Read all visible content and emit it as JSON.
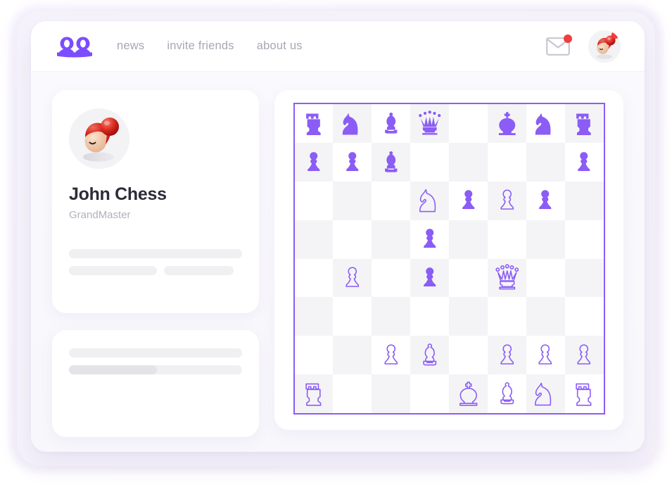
{
  "app": {
    "logo_name": "two-pawns-logo",
    "accent_color": "#7c4dff",
    "board_accent_color": "#8b5cf6",
    "notification_color": "#f03d3d",
    "page_background": "#f8f7fc"
  },
  "navbar": {
    "links": [
      {
        "label": "news",
        "name": "nav-link-news"
      },
      {
        "label": "invite friends",
        "name": "nav-link-invite-friends"
      },
      {
        "label": "about us",
        "name": "nav-link-about-us"
      }
    ],
    "mail_icon": "envelope-icon",
    "mail_badge": "",
    "avatar_icon": "user-avatar",
    "avatar_badge": ""
  },
  "profile": {
    "name": "John Chess",
    "role": "GrandMaster",
    "avatar_icon": "user-avatar",
    "skeleton_rows": [
      {
        "name": "skeleton-bar-full",
        "width": "100%",
        "tone": "light"
      },
      {
        "name": "skeleton-bar-half-left",
        "width": "51%",
        "tone": "light"
      },
      {
        "name": "skeleton-bar-half-right",
        "width": "40%",
        "tone": "light"
      }
    ]
  },
  "info_card": {
    "skeleton_rows": [
      {
        "name": "skeleton-bar-full",
        "width": "100%",
        "tone": "light"
      },
      {
        "name": "skeleton-bar-progress",
        "width": "100%",
        "tone": "light",
        "fill": "51%"
      }
    ]
  },
  "chess": {
    "files": [
      "a",
      "b",
      "c",
      "d",
      "e",
      "f",
      "g",
      "h"
    ],
    "ranks": [
      8,
      7,
      6,
      5,
      4,
      3,
      2,
      1
    ],
    "light_square_color": "#ffffff",
    "dark_square_color": "#f4f4f6",
    "border_color": "#8b5cf6",
    "black_piece_style": "filled",
    "white_piece_style": "outline",
    "position": [
      [
        {
          "sq": "a8",
          "piece": "rook",
          "color": "black"
        },
        {
          "sq": "b8",
          "piece": "knight",
          "color": "black"
        },
        {
          "sq": "c8",
          "piece": "bishop",
          "color": "black"
        },
        {
          "sq": "d8",
          "piece": "queen",
          "color": "black"
        },
        {
          "sq": "e8",
          "piece": null,
          "color": null
        },
        {
          "sq": "f8",
          "piece": "king",
          "color": "black"
        },
        {
          "sq": "g8",
          "piece": "knight",
          "color": "black"
        },
        {
          "sq": "h8",
          "piece": "rook",
          "color": "black"
        }
      ],
      [
        {
          "sq": "a7",
          "piece": "pawn",
          "color": "black"
        },
        {
          "sq": "b7",
          "piece": "pawn",
          "color": "black"
        },
        {
          "sq": "c7",
          "piece": "bishop",
          "color": "black"
        },
        {
          "sq": "d7",
          "piece": null,
          "color": null
        },
        {
          "sq": "e7",
          "piece": null,
          "color": null
        },
        {
          "sq": "f7",
          "piece": null,
          "color": null
        },
        {
          "sq": "g7",
          "piece": null,
          "color": null
        },
        {
          "sq": "h7",
          "piece": "pawn",
          "color": "black"
        }
      ],
      [
        {
          "sq": "a6",
          "piece": null,
          "color": null
        },
        {
          "sq": "b6",
          "piece": null,
          "color": null
        },
        {
          "sq": "c6",
          "piece": null,
          "color": null
        },
        {
          "sq": "d6",
          "piece": "knight",
          "color": "white"
        },
        {
          "sq": "e6",
          "piece": "pawn",
          "color": "black"
        },
        {
          "sq": "f6",
          "piece": "pawn",
          "color": "white"
        },
        {
          "sq": "g6",
          "piece": "pawn",
          "color": "black"
        },
        {
          "sq": "h6",
          "piece": null,
          "color": null
        }
      ],
      [
        {
          "sq": "a5",
          "piece": null,
          "color": null
        },
        {
          "sq": "b5",
          "piece": null,
          "color": null
        },
        {
          "sq": "c5",
          "piece": null,
          "color": null
        },
        {
          "sq": "d5",
          "piece": "pawn",
          "color": "black"
        },
        {
          "sq": "e5",
          "piece": null,
          "color": null
        },
        {
          "sq": "f5",
          "piece": null,
          "color": null
        },
        {
          "sq": "g5",
          "piece": null,
          "color": null
        },
        {
          "sq": "h5",
          "piece": null,
          "color": null
        }
      ],
      [
        {
          "sq": "a4",
          "piece": null,
          "color": null
        },
        {
          "sq": "b4",
          "piece": "pawn",
          "color": "white"
        },
        {
          "sq": "c4",
          "piece": null,
          "color": null
        },
        {
          "sq": "d4",
          "piece": "pawn",
          "color": "black"
        },
        {
          "sq": "e4",
          "piece": null,
          "color": null
        },
        {
          "sq": "f4",
          "piece": "queen",
          "color": "white"
        },
        {
          "sq": "g4",
          "piece": null,
          "color": null
        },
        {
          "sq": "h4",
          "piece": null,
          "color": null
        }
      ],
      [
        {
          "sq": "a3",
          "piece": null,
          "color": null
        },
        {
          "sq": "b3",
          "piece": null,
          "color": null
        },
        {
          "sq": "c3",
          "piece": null,
          "color": null
        },
        {
          "sq": "d3",
          "piece": null,
          "color": null
        },
        {
          "sq": "e3",
          "piece": null,
          "color": null
        },
        {
          "sq": "f3",
          "piece": null,
          "color": null
        },
        {
          "sq": "g3",
          "piece": null,
          "color": null
        },
        {
          "sq": "h3",
          "piece": null,
          "color": null
        }
      ],
      [
        {
          "sq": "a2",
          "piece": null,
          "color": null
        },
        {
          "sq": "b2",
          "piece": null,
          "color": null
        },
        {
          "sq": "c2",
          "piece": "pawn",
          "color": "white"
        },
        {
          "sq": "d2",
          "piece": "bishop",
          "color": "white"
        },
        {
          "sq": "e2",
          "piece": null,
          "color": null
        },
        {
          "sq": "f2",
          "piece": "pawn",
          "color": "white"
        },
        {
          "sq": "g2",
          "piece": "pawn",
          "color": "white"
        },
        {
          "sq": "h2",
          "piece": "pawn",
          "color": "white"
        }
      ],
      [
        {
          "sq": "a1",
          "piece": "rook",
          "color": "white"
        },
        {
          "sq": "b1",
          "piece": null,
          "color": null
        },
        {
          "sq": "c1",
          "piece": null,
          "color": null
        },
        {
          "sq": "d1",
          "piece": null,
          "color": null
        },
        {
          "sq": "e1",
          "piece": "king",
          "color": "white"
        },
        {
          "sq": "f1",
          "piece": "bishop",
          "color": "white"
        },
        {
          "sq": "g1",
          "piece": "knight",
          "color": "white"
        },
        {
          "sq": "h1",
          "piece": "rook",
          "color": "white"
        }
      ]
    ]
  }
}
